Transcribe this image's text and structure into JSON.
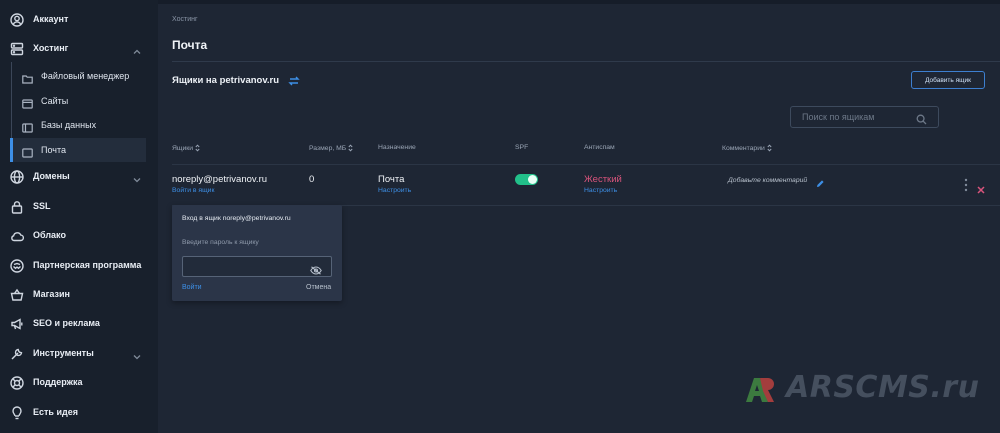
{
  "sidebar": {
    "items": [
      {
        "label": "Аккаунт",
        "icon": "user-circle-icon"
      },
      {
        "label": "Хостинг",
        "icon": "server-icon",
        "expanded": true
      },
      {
        "label": "Домены",
        "icon": "globe-icon"
      },
      {
        "label": "SSL",
        "icon": "lock-icon"
      },
      {
        "label": "Облако",
        "icon": "cloud-icon"
      },
      {
        "label": "Партнерская программа",
        "icon": "handshake-icon"
      },
      {
        "label": "Магазин",
        "icon": "basket-icon"
      },
      {
        "label": "SEO и реклама",
        "icon": "megaphone-icon"
      },
      {
        "label": "Инструменты",
        "icon": "tools-icon"
      },
      {
        "label": "Поддержка",
        "icon": "support-icon"
      },
      {
        "label": "Есть идея",
        "icon": "lightbulb-icon"
      }
    ],
    "hosting_sub": [
      {
        "label": "Файловый менеджер",
        "icon": "folder-icon"
      },
      {
        "label": "Сайты",
        "icon": "browser-icon"
      },
      {
        "label": "Базы данных",
        "icon": "database-icon"
      },
      {
        "label": "Почта",
        "icon": "mail-icon",
        "active": true
      }
    ]
  },
  "main": {
    "breadcrumb": "Хостинг",
    "title": "Почта",
    "section_title": "Ящики на petrivanov.ru",
    "add_button": "Добавить ящик",
    "search_placeholder": "Поиск по ящикам",
    "columns": {
      "mailbox": "Ящики",
      "size": "Размер, МБ",
      "purpose": "Назначение",
      "spf": "SPF",
      "antispam": "Антиспам",
      "comments": "Комментарии"
    },
    "row": {
      "email": "noreply@petrivanov.ru",
      "login_link": "Войти в ящик",
      "size": "0",
      "purpose": "Почта",
      "purpose_link": "Настроить",
      "spf_enabled": true,
      "antispam": "Жесткий",
      "antispam_link": "Настроить",
      "comment_placeholder": "Добавьте комментарий"
    },
    "login_popup": {
      "title": "Вход в ящик noreply@petrivanov.ru",
      "hint": "Введите пароль к ящику",
      "password_value": "",
      "login_label": "Войти",
      "cancel_label": "Отмена"
    }
  },
  "watermark": {
    "text": "ARSCMS.ru"
  },
  "colors": {
    "accent": "#3d8fe6",
    "toggle_on": "#22c08a",
    "danger": "#d9547c",
    "sidebar_bg": "#18202c",
    "main_bg": "#1e2634"
  }
}
